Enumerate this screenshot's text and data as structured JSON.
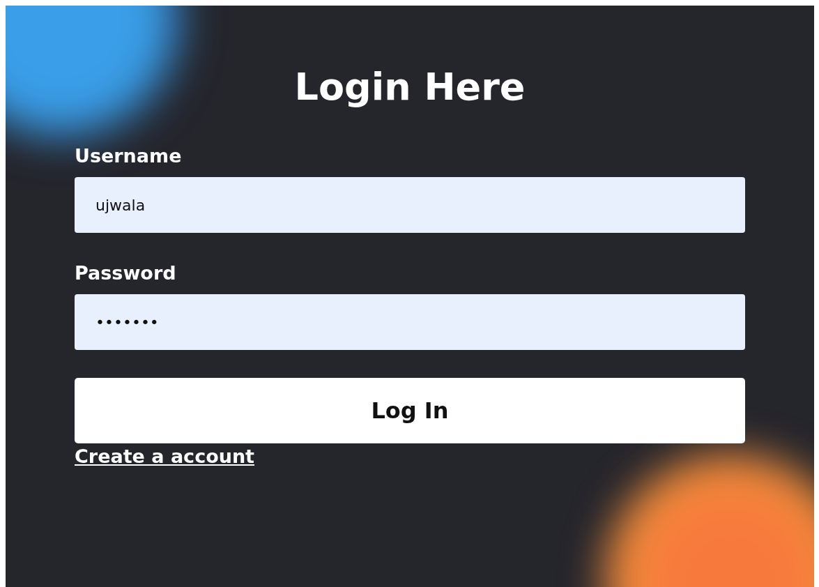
{
  "title": "Login Here",
  "fields": [
    {
      "label": "Username",
      "value": "ujwala"
    },
    {
      "label": "Password",
      "value": "•••••••"
    }
  ],
  "button": "Log In",
  "link": "Create a account"
}
